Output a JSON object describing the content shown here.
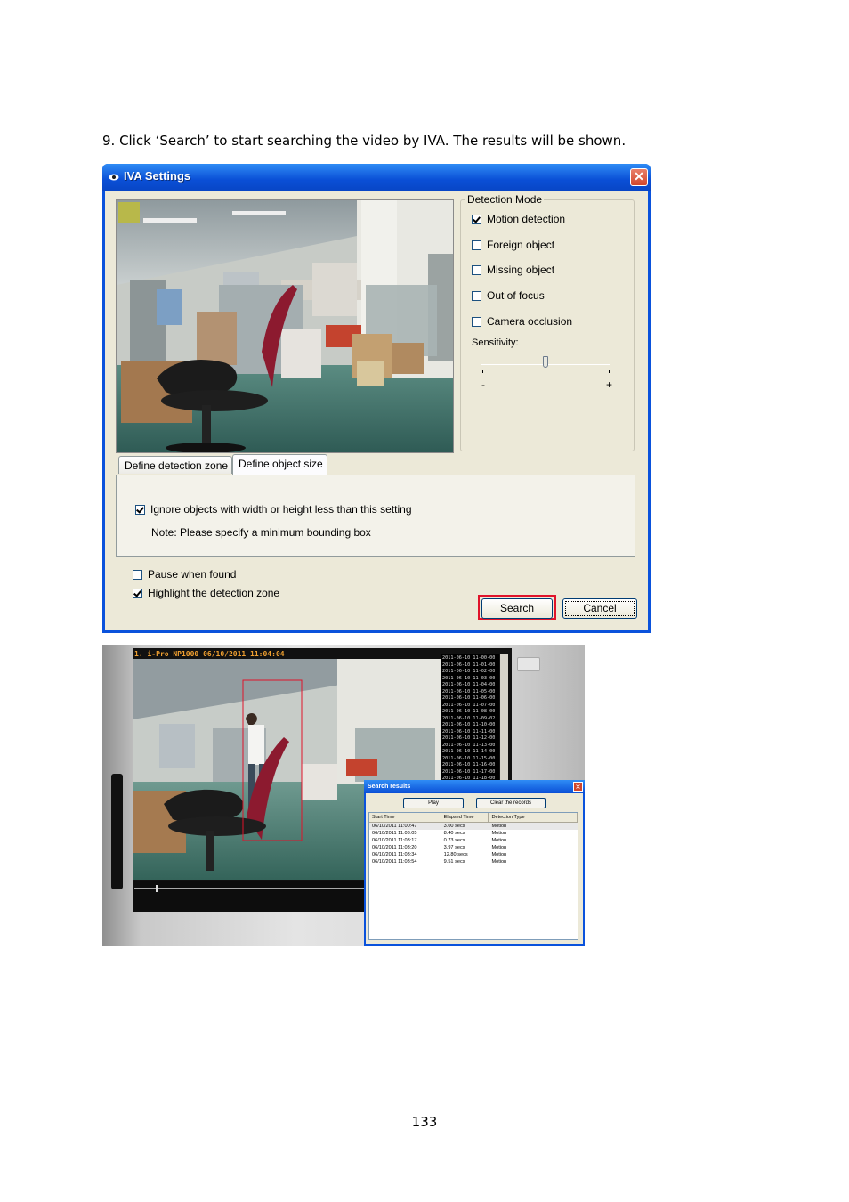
{
  "instruction": {
    "text": "9.  Click ‘Search’ to start searching the video by IVA.   The results will be shown."
  },
  "iva_dialog": {
    "title": "IVA Settings",
    "close_glyph": "✕",
    "detection_mode": {
      "legend": "Detection Mode",
      "options": [
        {
          "label": "Motion detection",
          "checked": true
        },
        {
          "label": "Foreign object",
          "checked": false
        },
        {
          "label": "Missing object",
          "checked": false
        },
        {
          "label": "Out of focus",
          "checked": false
        },
        {
          "label": "Camera occlusion",
          "checked": false
        }
      ],
      "sensitivity_label": "Sensitivity:",
      "sensitivity_value": 0.5,
      "slider_min_label": "-",
      "slider_max_label": "+"
    },
    "tabs": [
      "Define detection zone",
      "Define object size"
    ],
    "active_tab": "Define object size",
    "object_size": {
      "ignore_label": "Ignore objects with width or height less than this setting",
      "ignore_checked": true,
      "note": "Note: Please specify a minimum bounding box"
    },
    "pause_when_found": {
      "label": "Pause when found",
      "checked": false
    },
    "highlight_zone": {
      "label": "Highlight the detection zone",
      "checked": true
    },
    "buttons": {
      "search": "Search",
      "cancel": "Cancel"
    },
    "colors": {
      "title_bar": "#0a52dc",
      "highlight_box": "#e0132a",
      "dialog_bg": "#ece9d8"
    }
  },
  "player": {
    "caption": "1. i-Pro NP1000 06/10/2011 11:04:04",
    "event_list": [
      "2011-06-10 11-00-00",
      "2011-06-10 11-01-00",
      "2011-06-10 11-02-00",
      "2011-06-10 11-03-00",
      "2011-06-10 11-04-00",
      "2011-06-10 11-05-00",
      "2011-06-10 11-06-00",
      "2011-06-10 11-07-00",
      "2011-06-10 11-08-00",
      "2011-06-10 11-09-02",
      "2011-06-10 11-10-00",
      "2011-06-10 11-11-00",
      "2011-06-10 11-12-00",
      "2011-06-10 11-13-00",
      "2011-06-10 11-14-00",
      "2011-06-10 11-15-00",
      "2011-06-10 11-16-00",
      "2011-06-10 11-17-00",
      "2011-06-10 11-18-00"
    ]
  },
  "search_results": {
    "title": "Search results",
    "play_button": "Play",
    "clear_button": "Clear the records",
    "columns": [
      "Start Time",
      "Elapsed Time",
      "Detection Type"
    ],
    "rows": [
      [
        "06/10/2011 11:00:47",
        "3.00 secs",
        "Motion"
      ],
      [
        "06/10/2011 11:03:05",
        "8.40 secs",
        "Motion"
      ],
      [
        "06/10/2011 11:03:17",
        "0.73 secs",
        "Motion"
      ],
      [
        "06/10/2011 11:03:20",
        "3.97 secs",
        "Motion"
      ],
      [
        "06/10/2011 11:03:34",
        "12.80 secs",
        "Motion"
      ],
      [
        "06/10/2011 11:03:54",
        "9.51 secs",
        "Motion"
      ]
    ]
  },
  "page_number": "133"
}
